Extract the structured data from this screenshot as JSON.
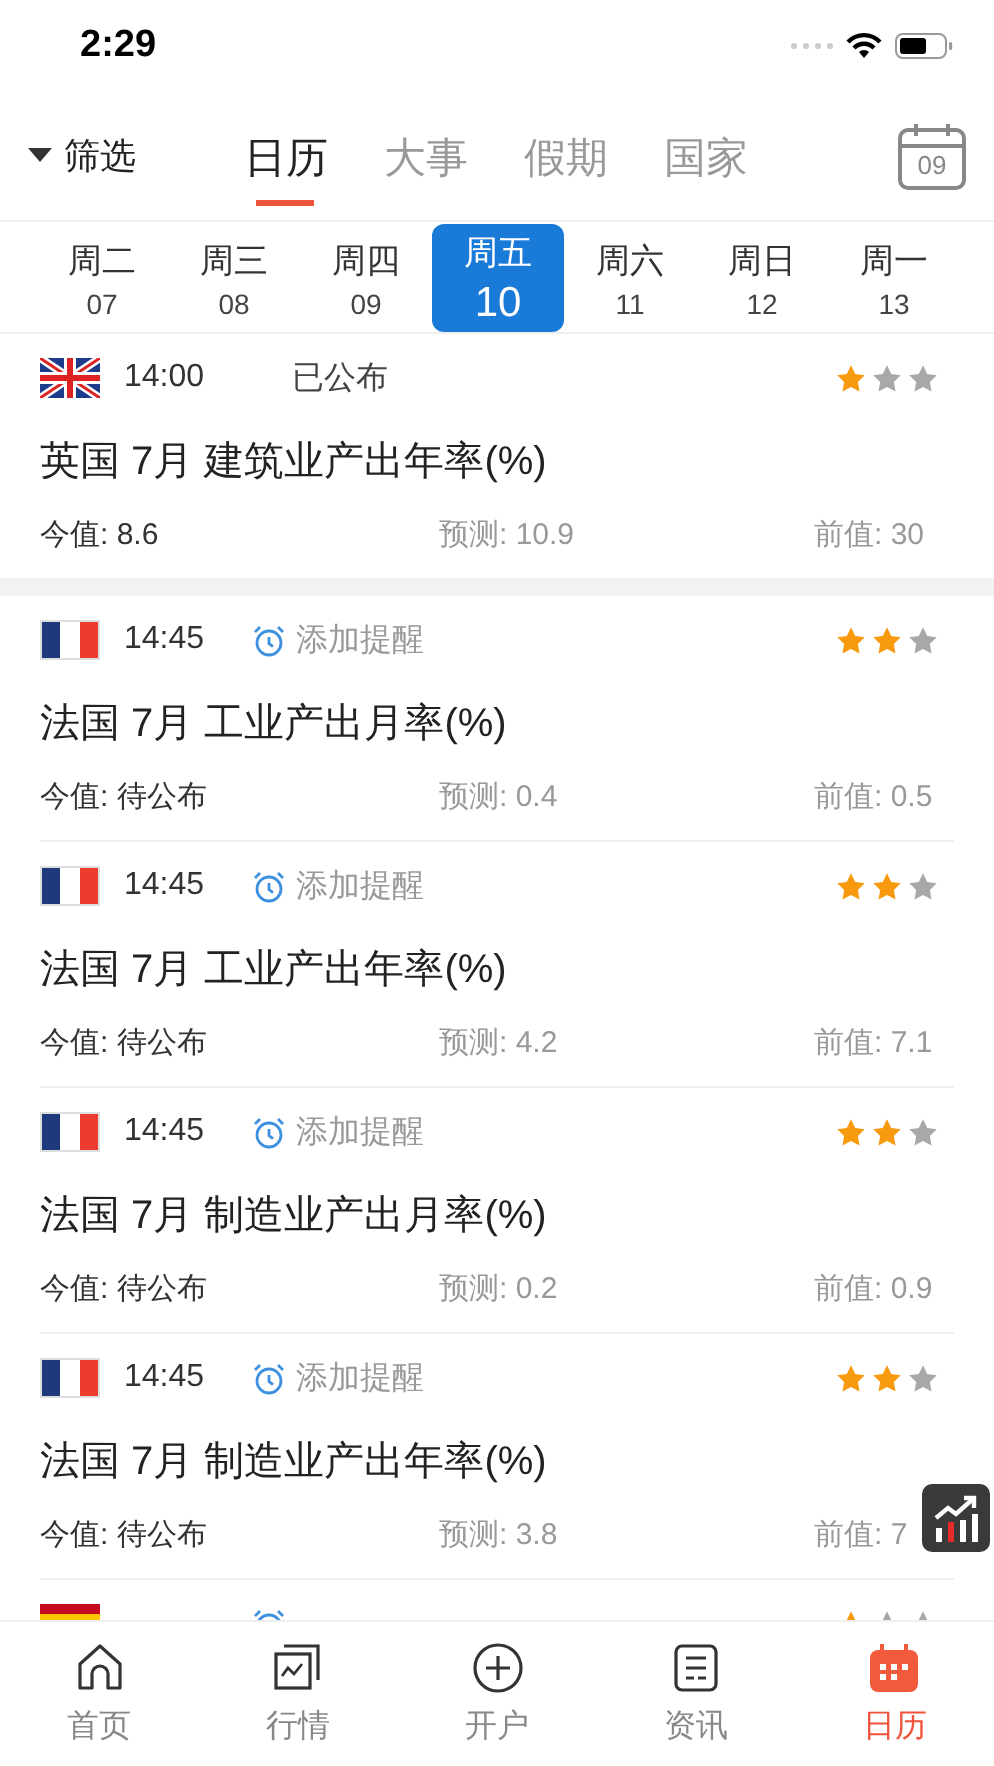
{
  "status_bar": {
    "time": "2:29"
  },
  "header": {
    "filter": "筛选",
    "calendar_day": "09",
    "tabs": [
      {
        "label": "日历",
        "selected": true
      },
      {
        "label": "大事",
        "selected": false
      },
      {
        "label": "假期",
        "selected": false
      },
      {
        "label": "国家",
        "selected": false
      }
    ]
  },
  "days": [
    {
      "weekday": "周二",
      "date": "07",
      "selected": false
    },
    {
      "weekday": "周三",
      "date": "08",
      "selected": false
    },
    {
      "weekday": "周四",
      "date": "09",
      "selected": false
    },
    {
      "weekday": "周五",
      "date": "10",
      "selected": true
    },
    {
      "weekday": "周六",
      "date": "11",
      "selected": false
    },
    {
      "weekday": "周日",
      "date": "12",
      "selected": false
    },
    {
      "weekday": "周一",
      "date": "13",
      "selected": false
    }
  ],
  "events": [
    {
      "flag": {
        "kind": "uk"
      },
      "time": "14:00",
      "kind": "published",
      "status": "已公布",
      "stars": 1,
      "title": "英国 7月 建筑业产出年率(%)",
      "actual": "今值: 8.6",
      "forecast": "预测: 10.9",
      "previous": "前值: 30"
    },
    {
      "flag": {
        "kind": "fr"
      },
      "time": "14:45",
      "kind": "reminder",
      "status": "添加提醒",
      "stars": 2,
      "title": "法国 7月 工业产出月率(%)",
      "actual": "今值: 待公布",
      "forecast": "预测: 0.4",
      "previous": "前值: 0.5"
    },
    {
      "flag": {
        "kind": "fr"
      },
      "time": "14:45",
      "kind": "reminder",
      "status": "添加提醒",
      "stars": 2,
      "title": "法国 7月 工业产出年率(%)",
      "actual": "今值: 待公布",
      "forecast": "预测: 4.2",
      "previous": "前值: 7.1"
    },
    {
      "flag": {
        "kind": "fr"
      },
      "time": "14:45",
      "kind": "reminder",
      "status": "添加提醒",
      "stars": 2,
      "title": "法国 7月 制造业产出月率(%)",
      "actual": "今值: 待公布",
      "forecast": "预测: 0.2",
      "previous": "前值: 0.9"
    },
    {
      "flag": {
        "kind": "fr"
      },
      "time": "14:45",
      "kind": "reminder",
      "status": "添加提醒",
      "stars": 2,
      "title": "法国 7月 制造业产出年率(%)",
      "actual": "今值: 待公布",
      "forecast": "预测: 3.8",
      "previous": "前值: 7"
    },
    {
      "flag": {
        "kind": "es"
      },
      "kind": "reminder",
      "stars": 1
    }
  ],
  "nav": [
    {
      "label": "首页",
      "selected": false
    },
    {
      "label": "行情",
      "selected": false
    },
    {
      "label": "开户",
      "selected": false
    },
    {
      "label": "资讯",
      "selected": false
    },
    {
      "label": "日历",
      "selected": true
    }
  ]
}
